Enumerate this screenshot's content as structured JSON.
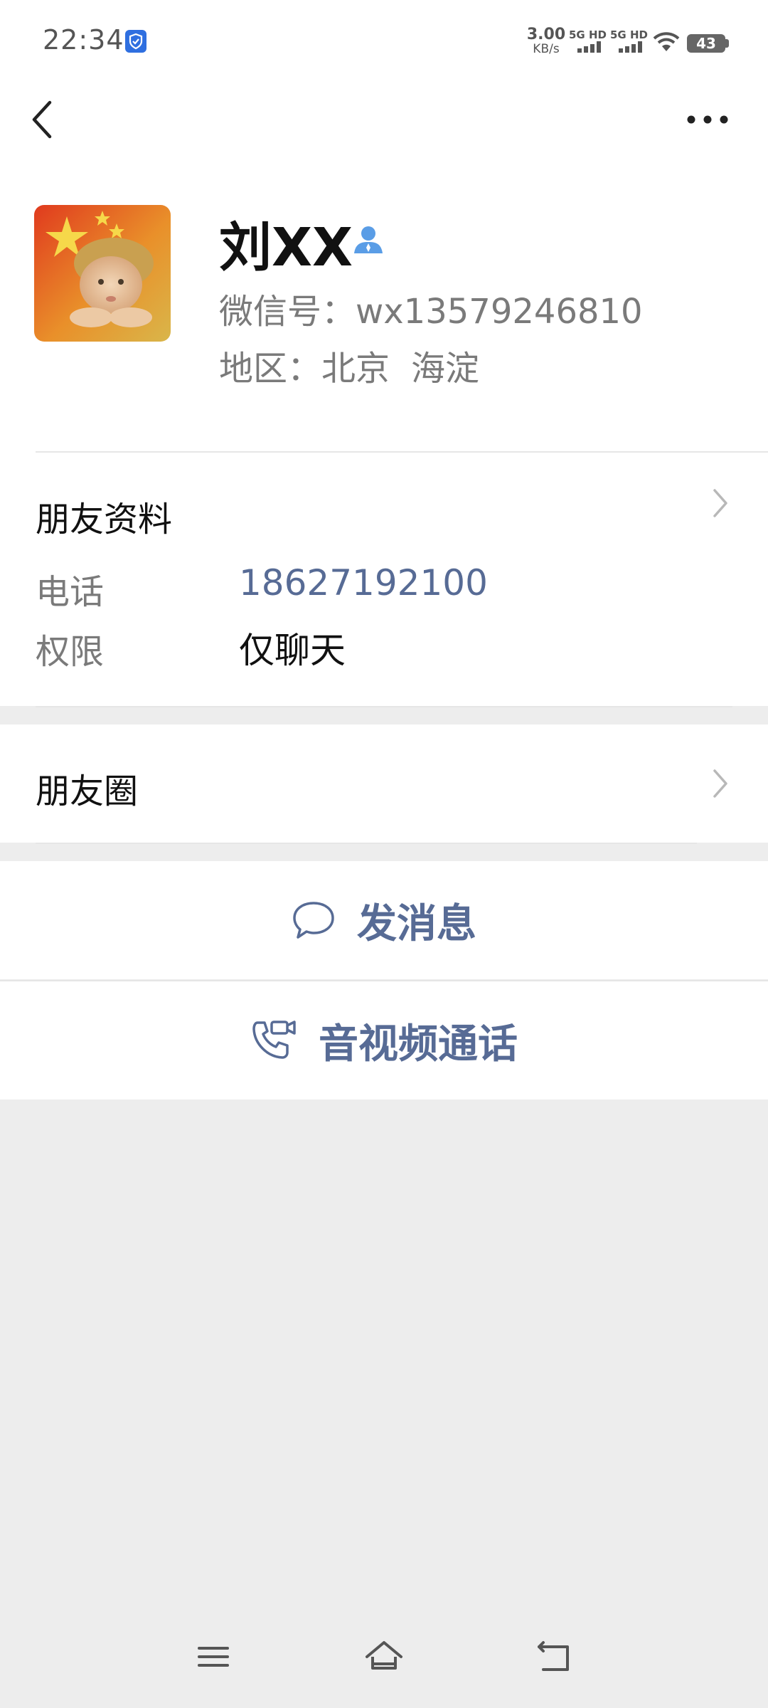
{
  "status_bar": {
    "time": "22:34",
    "net_speed_value": "3.00",
    "net_speed_unit": "KB/s",
    "sim1_label": "5G HD",
    "sim2_label": "5G HD",
    "battery": "43"
  },
  "profile": {
    "name": "刘XX",
    "wechat_id": "微信号：wx13579246810",
    "region_label": "地区：",
    "region_city": "北京",
    "region_district": "海淀"
  },
  "friend_info": {
    "title": "朋友资料",
    "phone_label": "电话",
    "phone_value": "18627192100",
    "permission_label": "权限",
    "permission_value": "仅聊天"
  },
  "moments": {
    "title": "朋友圈"
  },
  "actions": {
    "message_label": "发消息",
    "call_label": "音视频通话"
  },
  "colors": {
    "link": "#576b95",
    "background": "#ededed"
  },
  "icons": {
    "back": "back-arrow-icon",
    "more": "more-dots-icon",
    "contact": "person-icon",
    "message": "chat-bubble-icon",
    "call": "phone-video-icon",
    "nav_menu": "menu-icon",
    "nav_home": "home-icon",
    "nav_back": "return-icon"
  }
}
